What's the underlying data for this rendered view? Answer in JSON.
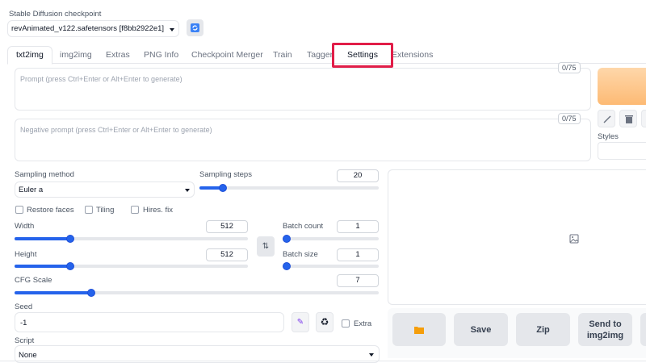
{
  "checkpoint": {
    "label": "Stable Diffusion checkpoint",
    "value": "revAnimated_v122.safetensors [f8bb2922e1]",
    "refresh_icon": "refresh-icon"
  },
  "tabs": [
    {
      "label": "txt2img",
      "active": true
    },
    {
      "label": "img2img"
    },
    {
      "label": "Extras"
    },
    {
      "label": "PNG Info"
    },
    {
      "label": "Checkpoint Merger"
    },
    {
      "label": "Train"
    },
    {
      "label": "Tagger"
    },
    {
      "label": "Settings",
      "highlighted": true
    },
    {
      "label": "Extensions"
    }
  ],
  "prompt": {
    "placeholder": "Prompt (press Ctrl+Enter or Alt+Enter to generate)",
    "counter": "0/75"
  },
  "negative_prompt": {
    "placeholder": "Negative prompt (press Ctrl+Enter or Alt+Enter to generate)",
    "counter": "0/75"
  },
  "right_panel": {
    "styles_label": "Styles",
    "icons": [
      "pencil-icon",
      "trash-icon"
    ]
  },
  "sampling": {
    "method_label": "Sampling method",
    "method_value": "Euler a",
    "steps_label": "Sampling steps",
    "steps_value": "20",
    "steps_fraction": 0.13
  },
  "options": {
    "restore_faces": "Restore faces",
    "tiling": "Tiling",
    "hires_fix": "Hires. fix"
  },
  "size": {
    "width_label": "Width",
    "width_value": "512",
    "width_fraction": 0.24,
    "height_label": "Height",
    "height_value": "512",
    "height_fraction": 0.24,
    "swap_icon": "swap-icon"
  },
  "batch": {
    "count_label": "Batch count",
    "count_value": "1",
    "count_fraction": 0.0,
    "size_label": "Batch size",
    "size_value": "1",
    "size_fraction": 0.0
  },
  "cfg": {
    "label": "CFG Scale",
    "value": "7",
    "fraction": 0.21
  },
  "seed": {
    "label": "Seed",
    "value": "-1",
    "dice_icon": "dice-icon",
    "recycle_icon": "recycle-icon",
    "extra_label": "Extra"
  },
  "script": {
    "label": "Script",
    "value": "None"
  },
  "output": {
    "image_icon": "image-placeholder-icon",
    "buttons": {
      "folder_icon": "folder-icon",
      "save": "Save",
      "zip": "Zip",
      "send_to_img2img": "Send to img2img"
    }
  },
  "colors": {
    "accent": "#2563eb",
    "highlight_box": "#e11d48",
    "generate_gradient_start": "#fed7aa",
    "generate_gradient_end": "#fdba74"
  }
}
